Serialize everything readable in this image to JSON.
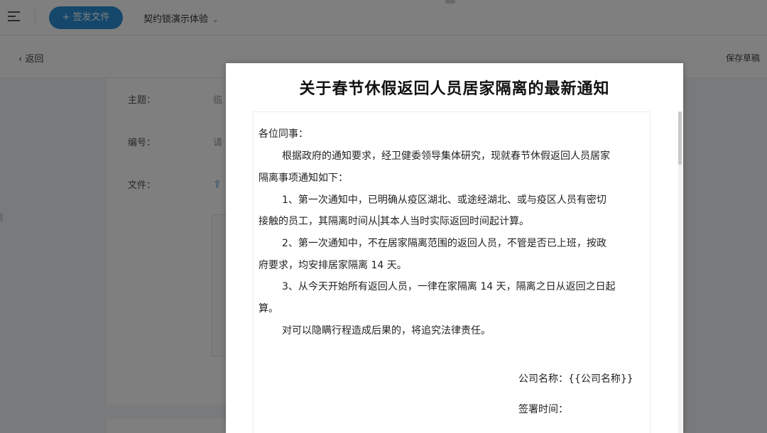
{
  "topbar": {
    "send_button_label": "+ 签发文件",
    "project_name": "契约锁演示体验"
  },
  "subbar": {
    "back_label": "返回",
    "save_draft_label": "保存草稿"
  },
  "form": {
    "subject_label": "主题：",
    "subject_value": "临",
    "number_label": "编号：",
    "number_value": "请",
    "file_label": "文件："
  },
  "document": {
    "title": "关于春节休假返回人员居家隔离的最新通知",
    "greeting": "各位同事：",
    "lines": [
      "根据政府的通知要求，经卫健委领导集体研究，现就春节休假返回人员居家",
      "隔离事项通知如下：",
      "1、第一次通知中，已明确从疫区湖北、或途经湖北、或与疫区人员有密切",
      "接触的员工，其隔离时间从",
      "其本人当时实际返回时间起计算。",
      "2、第一次通知中，不在居家隔离范围的返回人员，不管是否已上班，按政",
      "府要求，均安排居家隔离 14 天。",
      "3、从今天开始所有返回人员，一律在家隔离 14 天，隔离之日从返回之日起",
      "算。",
      "对可以隐瞒行程造成后果的，将追究法律责任。"
    ],
    "company_line": "公司名称：{{公司名称}}",
    "sign_time_line": "签署时间："
  }
}
